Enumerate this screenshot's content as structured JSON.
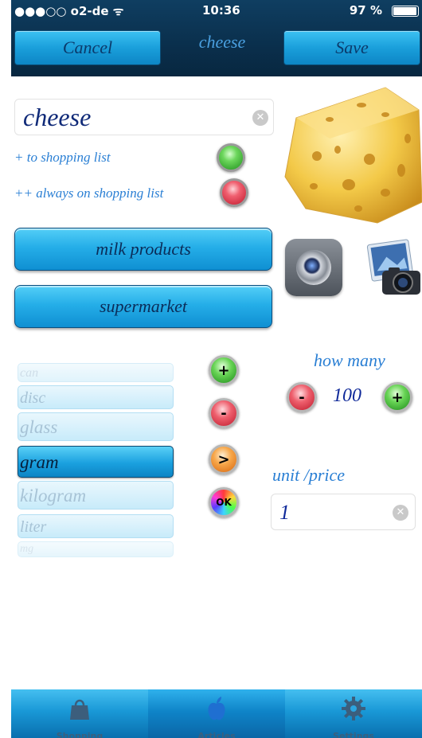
{
  "status": {
    "carrier": "●●●○○ o2-de",
    "wifi": "ᯤ",
    "time": "10:36",
    "battery": "97 %"
  },
  "nav": {
    "cancel": "Cancel",
    "title": "cheese",
    "save": "Save"
  },
  "item": {
    "name": "cheese",
    "add_shopping": "+ to shopping list",
    "always_shopping": "++ always on shopping list",
    "category": "milk products",
    "store": "supermarket"
  },
  "picker": {
    "rows": [
      "can",
      "disc",
      "glass",
      "gram",
      "kilogram",
      "liter",
      "mg"
    ],
    "selected": "gram"
  },
  "buttons": {
    "add": "+",
    "remove": "-",
    "next": ">",
    "ok": "OK"
  },
  "quantity": {
    "label": "how many",
    "value": "100",
    "minus": "-",
    "plus": "+"
  },
  "unit_price": {
    "label": "unit /price",
    "value": "1"
  },
  "tabs": [
    {
      "label": "Shopping"
    },
    {
      "label": "Articles"
    },
    {
      "label": "Settings"
    }
  ],
  "colors": {
    "accent": "#1aa0df",
    "nav_bg": "#0a2f4c",
    "text_blue": "#2a7fd4"
  }
}
